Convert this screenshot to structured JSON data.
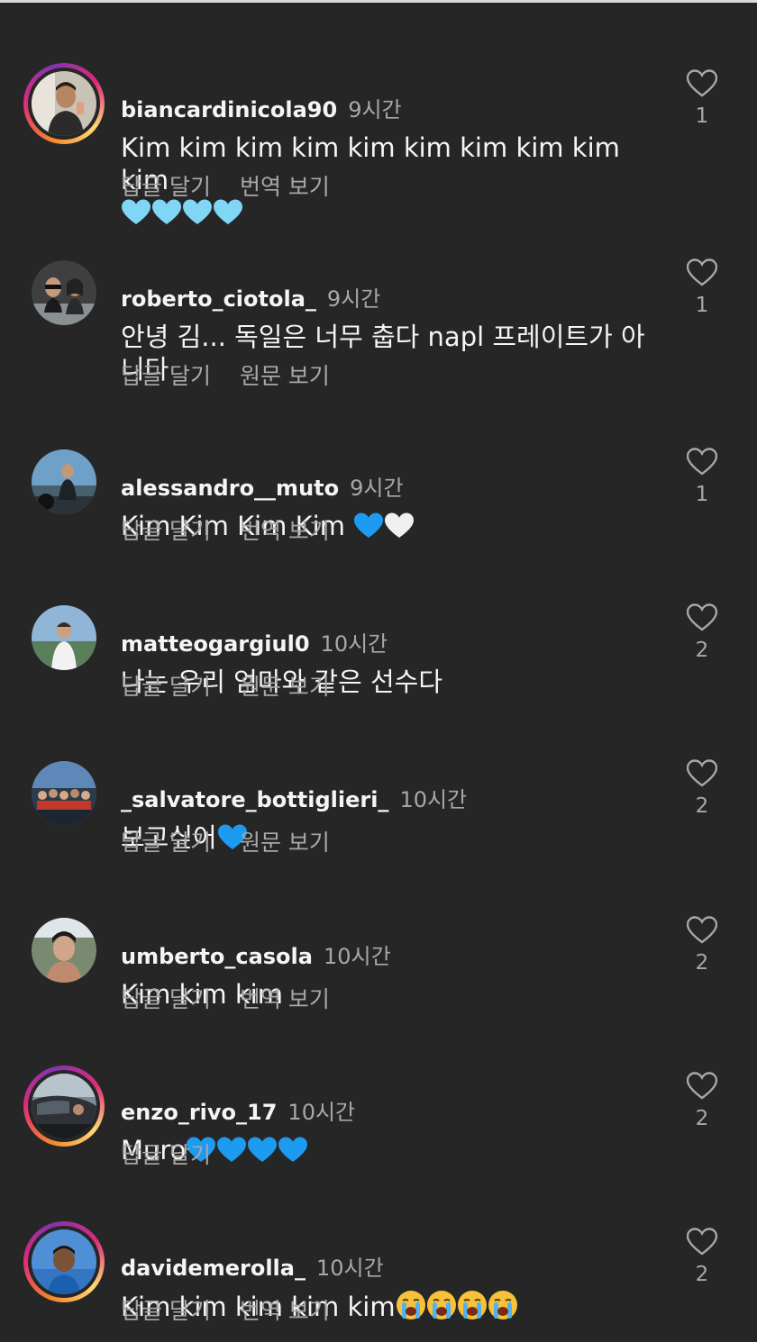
{
  "comments": [
    {
      "username": "biancardinicola90",
      "time": "9시간",
      "text": "Kim kim kim kim kim kim kim kim kim kim",
      "emoji_line": [
        "light-blue-heart",
        "light-blue-heart",
        "light-blue-heart",
        "light-blue-heart"
      ],
      "actions": [
        "답글 달기",
        "번역 보기"
      ],
      "likes": "1",
      "story_ring": true
    },
    {
      "username": "roberto_ciotola_",
      "time": "9시간",
      "text": "안녕 김... 독일은 너무 춥다 napl 프레이트가 아니다",
      "actions": [
        "답글 달기",
        "원문 보기"
      ],
      "likes": "1",
      "story_ring": false
    },
    {
      "username": "alessandro__muto",
      "time": "9시간",
      "text": "Kim Kim Kim Kim",
      "actions": [
        "답글 달기",
        "번역 보기"
      ],
      "likes": "1",
      "story_ring": false
    },
    {
      "username": "matteogargiul0",
      "time": "10시간",
      "text": "나는 우리 엄마와 같은 선수다",
      "actions": [
        "답글 달기",
        "원문 보기"
      ],
      "likes": "2",
      "story_ring": false
    },
    {
      "username": "_salvatore_bottiglieri_",
      "time": "10시간",
      "text": "보고싶어",
      "actions": [
        "답글 달기",
        "원문 보기"
      ],
      "likes": "2",
      "story_ring": false
    },
    {
      "username": "umberto_casola",
      "time": "10시간",
      "text": "Kim kim kim",
      "actions": [
        "답글 달기",
        "번역 보기"
      ],
      "likes": "2",
      "story_ring": false
    },
    {
      "username": "enzo_rivo_17",
      "time": "10시간",
      "text": "Muro",
      "actions": [
        "답글 달기"
      ],
      "likes": "2",
      "story_ring": true
    },
    {
      "username": "davidemerolla_",
      "time": "10시간",
      "text": "Kim kim kim kim kim",
      "actions": [
        "답글 달기",
        "번역 보기"
      ],
      "likes": "2",
      "story_ring": true
    }
  ],
  "colors": {
    "background": "#262626",
    "primary_text": "#f5f5f5",
    "secondary_text": "#a8a8a8",
    "blue_heart": "#1d9bf0",
    "light_blue_heart": "#7fd6f5"
  },
  "icons": {
    "like": "heart-outline-icon"
  }
}
